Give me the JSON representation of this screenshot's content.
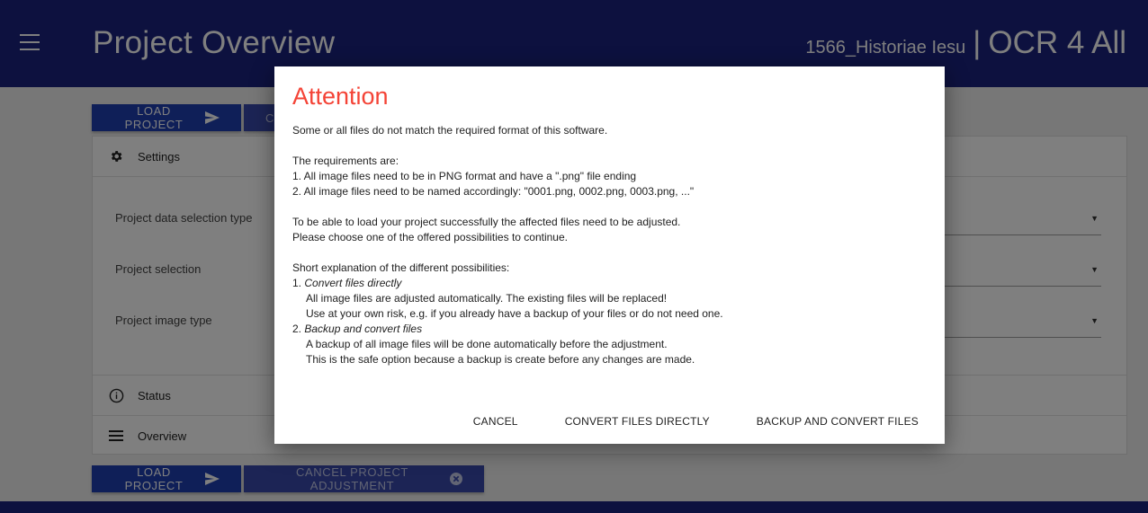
{
  "header": {
    "title": "Project Overview",
    "project_name": "1566_Historiae Iesu",
    "separator": "|",
    "app_name": "OCR 4 All"
  },
  "toolbar_top": {
    "load_label": "LOAD PROJECT",
    "cancel_partial": "CA"
  },
  "card": {
    "settings_label": "Settings",
    "fields": [
      {
        "label": "Project data selection type"
      },
      {
        "label": "Project selection"
      },
      {
        "label": "Project image type"
      }
    ],
    "status_label": "Status",
    "overview_label": "Overview"
  },
  "toolbar_bottom": {
    "load_label": "LOAD PROJECT",
    "cancel_label": "CANCEL PROJECT ADJUSTMENT"
  },
  "dialog": {
    "title": "Attention",
    "intro": "Some or all files do not match the required format of this software.",
    "requirements_heading": "The requirements are:",
    "requirement_1": "1. All image files need to be in PNG format and have a \".png\" file ending",
    "requirement_2": "2. All image files need to be named accordingly: \"0001.png, 0002.png, 0003.png, ...\"",
    "adjust_line_1": "To be able to load your project successfully the affected files need to be adjusted.",
    "adjust_line_2": "Please choose one of the offered possibilities to continue.",
    "explanation_heading": "Short explanation of the different possibilities:",
    "option_1_number": "1.",
    "option_1_title": "Convert files directly",
    "option_1_line_1": "All image files are adjusted automatically. The existing files will be replaced!",
    "option_1_line_2": "Use at your own risk, e.g. if you already have a backup of your files or do not need one.",
    "option_2_number": "2.",
    "option_2_title": "Backup and convert files",
    "option_2_line_1": "A backup of all image files will be done automatically before the adjustment.",
    "option_2_line_2": "This is the safe option because a backup is create before any changes are made.",
    "actions": {
      "cancel": "CANCEL",
      "convert": "CONVERT FILES DIRECTLY",
      "backup_convert": "BACKUP AND CONVERT FILES"
    }
  },
  "colors": {
    "header_bg": "#1a237e",
    "primary_button": "#1e3fb0",
    "secondary_button": "#3949ab",
    "title_red": "#f44336"
  }
}
